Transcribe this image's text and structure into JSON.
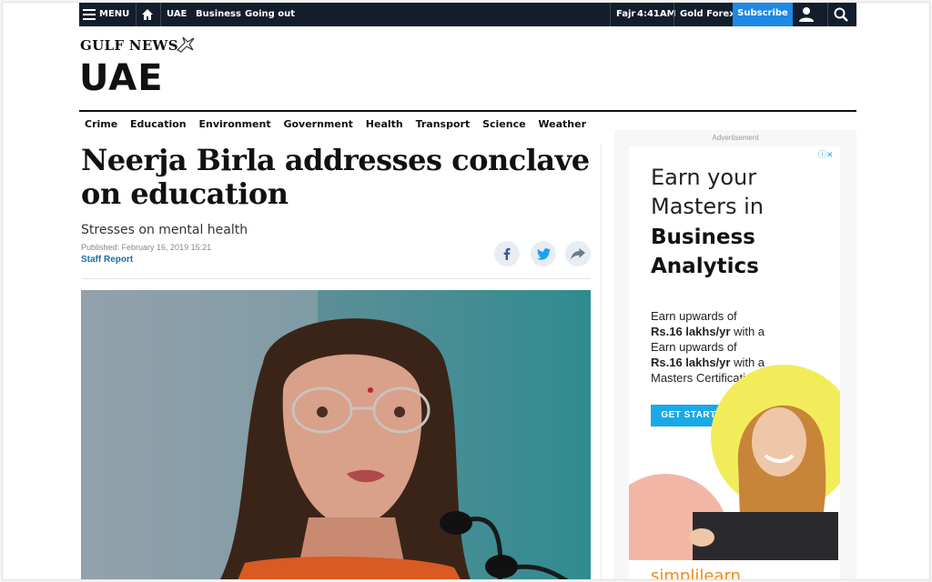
{
  "topbar": {
    "menu_label": "MENU",
    "nav": [
      "UAE",
      "Business",
      "Going out"
    ],
    "prayer_name": "Fajr",
    "prayer_time": "4:41AM",
    "gold_forex": "Gold Forex",
    "subscribe": "Subscribe",
    "icons": [
      "menu-icon",
      "home-icon",
      "user-icon",
      "search-icon"
    ],
    "bg_color": "#121e2c",
    "accent_color": "#1e88e5"
  },
  "masthead": {
    "brand": "GULF NEWS",
    "section": "UAE"
  },
  "subnav": [
    "Crime",
    "Education",
    "Environment",
    "Government",
    "Health",
    "Transport",
    "Science",
    "Weather"
  ],
  "article": {
    "headline": "Neerja Birla addresses conclave on education",
    "deck": "Stresses on mental health",
    "published": "Published:  February 16, 2019 15:21",
    "byline": "Staff Report",
    "share_icons": [
      "facebook-icon",
      "twitter-icon",
      "share-icon"
    ],
    "byline_color": "#1a6fa8"
  },
  "ad": {
    "label": "Advertisement",
    "headline_1": "Earn your",
    "headline_2": "Masters in",
    "headline_3": "Business",
    "headline_4": "Analytics",
    "body_1": "Earn upwards of",
    "body_2_bold": "Rs.16 lakhs/yr",
    "body_2_rest": " with a",
    "body_3": "Earn upwards of",
    "body_4_bold": "Rs.16 lakhs/yr",
    "body_4_rest": " with a",
    "body_5": "Masters Certification",
    "cta": "GET STARTED",
    "logo": "simplilearn",
    "cta_color": "#1aa9e8"
  }
}
